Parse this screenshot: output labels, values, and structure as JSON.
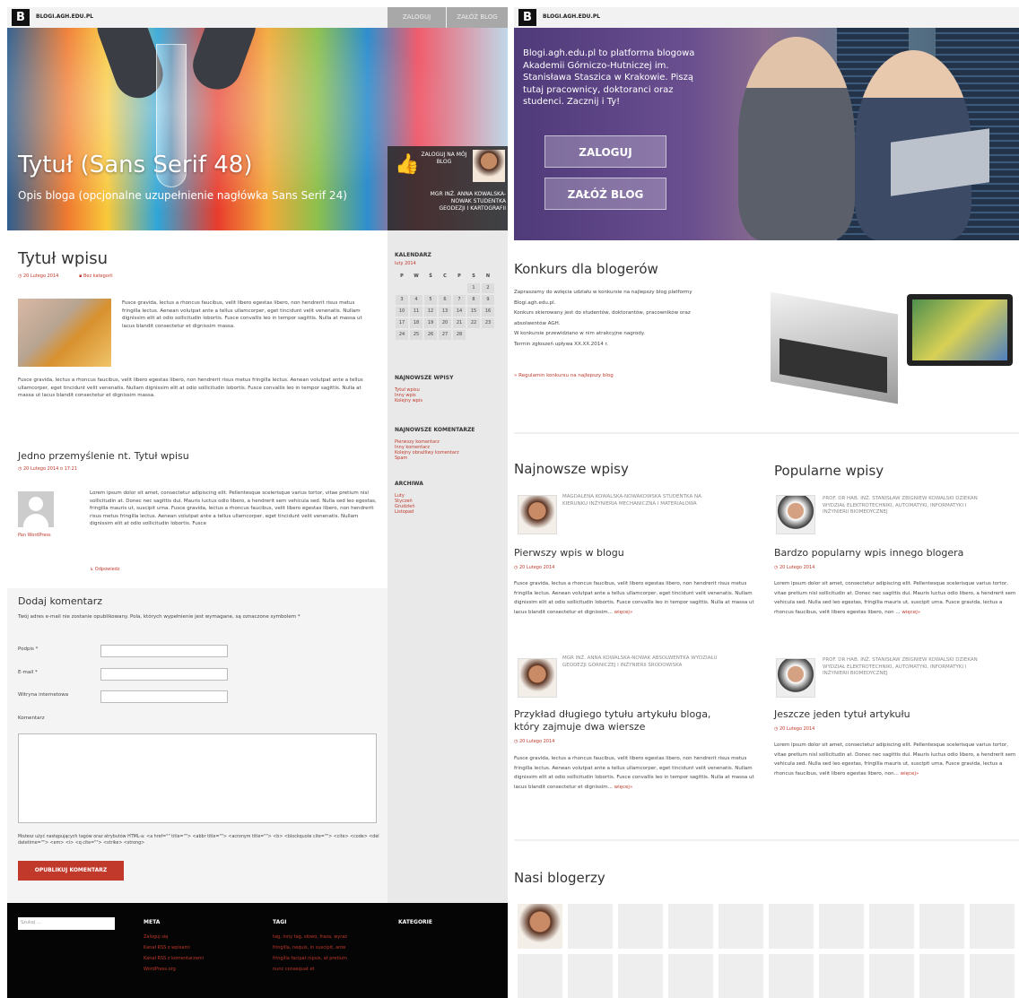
{
  "site_name": "BLOGI.AGH.EDU.PL",
  "colors": {
    "accent": "#c0392b",
    "footer": "#050505",
    "sidebar": "#e9e9e9"
  },
  "left": {
    "topbar": {
      "login": "ZALOGUJ",
      "create": "ZAŁÓŻ BLOG"
    },
    "hero": {
      "title": "Tytuł (Sans Serif 48)",
      "desc": "Opis bloga (opcjonalne uzupełnienie nagłówka Sans Serif 24)",
      "login_msg": "ZALOGUJ NA MÓJ BLOG",
      "author": "MGR INŻ. ANNA KOWALSKA-NOWAK STUDENTKA GEODEZJI I KARTOGRAFII"
    },
    "post": {
      "title": "Tytuł wpisu",
      "date": "20 Lutego 2014",
      "category": "Bez kategorii",
      "para1": "Fusce gravida, lectus a rhoncus faucibus, velit libero egestas libero, non hendrerit risus metus fringilla lectus. Aenean volutpat ante a tellus ullamcorper, eget tincidunt velit venenatis. Nullam dignissim elit at odio sollicitudin lobortis. Fusce convallis leo in tempor sagittis. Nulla at massa ut lacus blandit consectetur et dignissim massa.",
      "para2": "Fusce gravida, lectus a rhoncus faucibus, velit libero egestas libero, non hendrerit risus metus fringilla lectus. Aenean volutpat ante a tellus ullamcorper, eget tincidunt velit venenatis. Nullam dignissim elit at odio sollicitudin lobortis. Fusce convallis leo in tempor sagittis. Nulla at massa ut lacus blandit consectetur et dignissim massa."
    },
    "comments": {
      "title": "Jedno przemyślenie nt. Tytuł wpisu",
      "date": "20 Lutego 2014 o 17:21",
      "author": "Pan WordPress",
      "text": "Lorem ipsum dolor sit amet, consectetur adipiscing elit. Pellentesque scelerisque varius tortor, vitae pretium nisl sollicitudin at. Donec nec sagittis dui. Mauris luctus odio libero, a hendrerit sem vehicula sed. Nulla sed leo egestas, fringilla mauris ut, suscipit urna. Fusce gravida, lectus a rhoncus faucibus, velit libero egestas libero, non hendrerit risus metus fringilla lectus. Aenean volutpat ante a tellus ullamcorper, eget tincidunt velit venenatis. Nullam dignissim elit at odio sollicitudin lobortis. Fusce",
      "reply": "Odpowiedz"
    },
    "form": {
      "title": "Dodaj komentarz",
      "note": "Twój adres e-mail nie zostanie opublikowany. Pola, których wypełnienie jest wymagane, są oznaczone symbolem *",
      "name_label": "Podpis *",
      "email_label": "E-mail *",
      "site_label": "Witryna internetowa",
      "comment_label": "Komentarz",
      "tags_note": "Możesz użyć następujących tagów oraz atrybutów HTML-a: <a href=\"\" title=\"\"> <abbr title=\"\"> <acronym title=\"\"> <b> <blockquote cite=\"\"> <cite> <code> <del datetime=\"\"> <em> <i> <q cite=\"\"> <strike> <strong>",
      "submit": "OPUBLIKUJ KOMENTARZ"
    },
    "sidebar": {
      "calendar_h": "KALENDARZ",
      "month": "luty 2014",
      "days": [
        "P",
        "W",
        "Ś",
        "C",
        "P",
        "S",
        "N"
      ],
      "weeks": [
        [
          "",
          "",
          "",
          "",
          "",
          "1",
          "2"
        ],
        [
          "3",
          "4",
          "5",
          "6",
          "7",
          "8",
          "9"
        ],
        [
          "10",
          "11",
          "12",
          "13",
          "14",
          "15",
          "16"
        ],
        [
          "17",
          "18",
          "19",
          "20",
          "21",
          "22",
          "23"
        ],
        [
          "24",
          "25",
          "26",
          "27",
          "28",
          "",
          ""
        ]
      ],
      "recent_h": "NAJNOWSZE WPISY",
      "recent": [
        "Tytuł wpisu",
        "Inny wpis",
        "Kolejny wpis"
      ],
      "comments_h": "NAJNOWSZE KOMENTARZE",
      "comments": [
        "Pierwszy komentarz",
        "Inny komentarz",
        "Kolejny obraźliwy komentarz",
        "Spam"
      ],
      "archive_h": "ARCHIWA",
      "archive": [
        "Luty",
        "Styczeń",
        "Grudzień",
        "Listopad"
      ]
    },
    "footer": {
      "search": "Szukaj …",
      "meta_h": "META",
      "meta": [
        "Zaloguj się",
        "Kanał RSS z wpisami",
        "Kanał RSS z komentarzami",
        "WordPress.org"
      ],
      "tags_h": "TAGI",
      "tags": [
        "tag, inny tag, słowo, fraza, wyraz",
        "fringilla, nequis, in suscipit, ante",
        "fringilla facipat nipsis, at pretium",
        "nunc consequat et"
      ],
      "cat_h": "KATEGORIE"
    }
  },
  "right": {
    "hero": {
      "text": "Blogi.agh.edu.pl to platforma blogowa Akademii Górniczo-Hutniczej im. Stanisława Staszica w Krakowie. Piszą tutaj pracownicy, doktoranci oraz studenci. Zacznij i Ty!",
      "login": "ZALOGUJ",
      "create": "ZAŁÓŻ BLOG"
    },
    "contest": {
      "title": "Konkurs dla blogerów",
      "lines": [
        "Zapraszamy do wzięcia udziału w konkursie na najlepszy blog platformy Blogi.agh.edu.pl.",
        "Konkurs skierowany jest do studentów, doktorantów, pracowników oraz absolwentów AGH.",
        "W konkursie przewidziano w nim atrakcyjne nagrody.",
        "Termin zgłoszeń upływa XX.XX.2014 r."
      ],
      "link": "» Regulamin konkursu na najlepszy blog"
    },
    "newest": {
      "title": "Najnowsze wpisy",
      "items": [
        {
          "author": "MAGDALENA KOWALSKA-NOWAKOWSKA STUDENTKA NA KIERUNKU INŻYNIERIA MECHANICZNA I MATERIAŁOWA",
          "title": "Pierwszy wpis w blogu",
          "date": "20 Lutego 2014",
          "text": "Fusce gravida, lectus a rhoncus faucibus, velit libero egestas libero, non hendrerit risus metus fringilla lectus. Aenean volutpat ante a tellus ullamcorper, eget tincidunt velit venenatis. Nullam dignissim elit at odio sollicitudin lobortis. Fusce convallis leo in tempor sagittis. Nulla at massa ut lacus blandit consectetur et dignissim...",
          "more": "więcej»"
        },
        {
          "author": "MGR INŻ. ANNA KOWALSKA-NOWAK ABSOLWENTKA WYDZIAŁU GEODEZJI GÓRNICZEJ I INŻYNIERII ŚRODOWISKA",
          "title": "Przykład długiego tytułu artykułu bloga, który zajmuje dwa wiersze",
          "date": "20 Lutego 2014",
          "text": "Fusce gravida, lectus a rhoncus faucibus, velit libero egestas libero, non hendrerit risus metus fringilla lectus. Aenean volutpat ante a tellus ullamcorper, eget tincidunt velit venenatis. Nullam dignissim elit at odio sollicitudin lobortis. Fusce convallis leo in tempor sagittis. Nulla at massa ut lacus blandit consectetur et dignissim...",
          "more": "więcej»"
        }
      ]
    },
    "popular": {
      "title": "Popularne wpisy",
      "items": [
        {
          "author": "PROF. DR HAB. INŻ. STANISŁAW ZBIGNIEW KOWALSKI DZIEKAN WYDZIAŁ ELEKTROTECHNIKI, AUTOMATYKI, INFORMATYKI I INŻYNIERII BIOMEDYCZNEJ",
          "title": "Bardzo popularny wpis innego blogera",
          "date": "20 Lutego 2014",
          "text": "Lorem ipsum dolor sit amet, consectetur adipiscing elit. Pellentesque scelerisque varius tortor, vitae pretium nisl sollicitudin at. Donec nec sagittis dui. Mauris luctus odio libero, a hendrerit sem vehicula sed. Nulla sed leo egestas, fringilla mauris ut, suscipit urna. Fusce gravida, lectus a rhoncus faucibus, velit libero egestas libero, non ...",
          "more": "więcej»"
        },
        {
          "author": "PROF. DR HAB. INŻ. STANISŁAW ZBIGNIEW KOWALSKI DZIEKAN WYDZIAŁ ELEKTROTECHNIKI, AUTOMATYKI, INFORMATYKI I INŻYNIERII BIOMEDYCZNEJ",
          "title": "Jeszcze jeden tytuł artykułu",
          "date": "20 Lutego 2014",
          "text": "Lorem ipsum dolor sit amet, consectetur adipiscing elit. Pellentesque scelerisque varius tortor, vitae pretium nisl sollicitudin at. Donec nec sagittis dui. Mauris luctus odio libero, a hendrerit sem vehicula sed. Nulla sed leo egestas, fringilla mauris ut, suscipit urna. Fusce gravida, lectus a rhoncus faucibus, velit libero egestas libero, non...",
          "more": "więcej»"
        }
      ]
    },
    "bloggers": {
      "title": "Nasi blogerzy"
    }
  }
}
